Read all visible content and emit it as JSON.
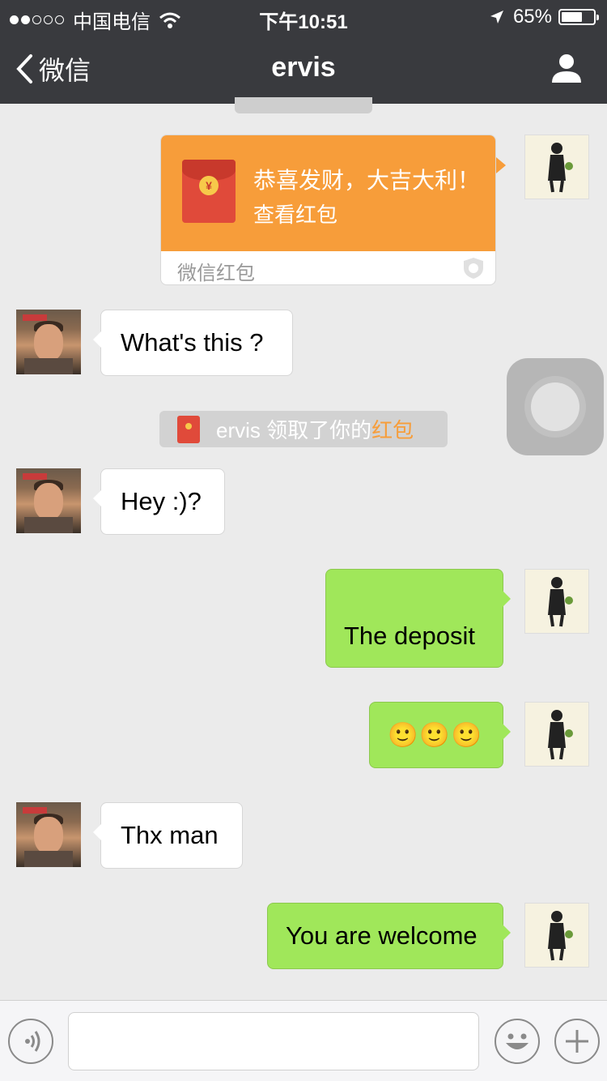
{
  "status_bar": {
    "carrier": "中国电信",
    "time": "下午10:51",
    "battery": "65%",
    "battery_level": 0.65
  },
  "nav": {
    "back_label": "微信",
    "title": "ervis"
  },
  "red_packet": {
    "greeting": "恭喜发财，大吉大利！",
    "action": "查看红包",
    "footer": "微信红包",
    "coin_symbol": "¥"
  },
  "messages": [
    {
      "from": "friend",
      "text": "What's this ?"
    },
    {
      "from": "friend",
      "text": "Hey :)?"
    },
    {
      "from": "me",
      "text": "The deposit"
    },
    {
      "from": "me",
      "text": "🙂🙂🙂"
    },
    {
      "from": "friend",
      "text": "Thx man"
    },
    {
      "from": "me",
      "text": "You are welcome"
    }
  ],
  "system_message": {
    "prefix": "ervis 领取了你的",
    "highlight": "红包"
  },
  "colors": {
    "nav_bg": "#393a3e",
    "red_packet_orange": "#f79d3a",
    "sent_bubble": "#a0e75a",
    "chat_bg": "#ebebeb"
  }
}
